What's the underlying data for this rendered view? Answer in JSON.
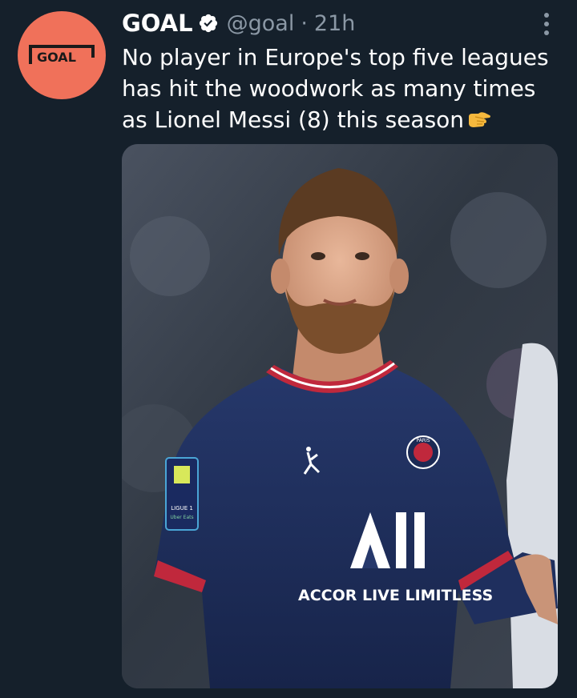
{
  "tweet": {
    "display_name": "GOAL",
    "handle": "@goal",
    "separator": "·",
    "time": "21h",
    "text": "No player in Europe's top five leagues has hit the woodwork as many times as Lionel Messi (8) this season",
    "emoji": "pointing-hand-emoji"
  },
  "avatar": {
    "logo_text": "GOAL",
    "color": "#f0715a"
  },
  "media": {
    "shirt_sponsor": "ACCOR LIVE LIMITLESS",
    "league_badge": "LIGUE 1",
    "league_badge_sub": "Uber Eats",
    "crest_text": "PARIS"
  },
  "colors": {
    "background": "#15202b",
    "secondary_text": "#8b98a5",
    "verified_badge": "#ffffff",
    "shirt": "#1d2c56"
  }
}
